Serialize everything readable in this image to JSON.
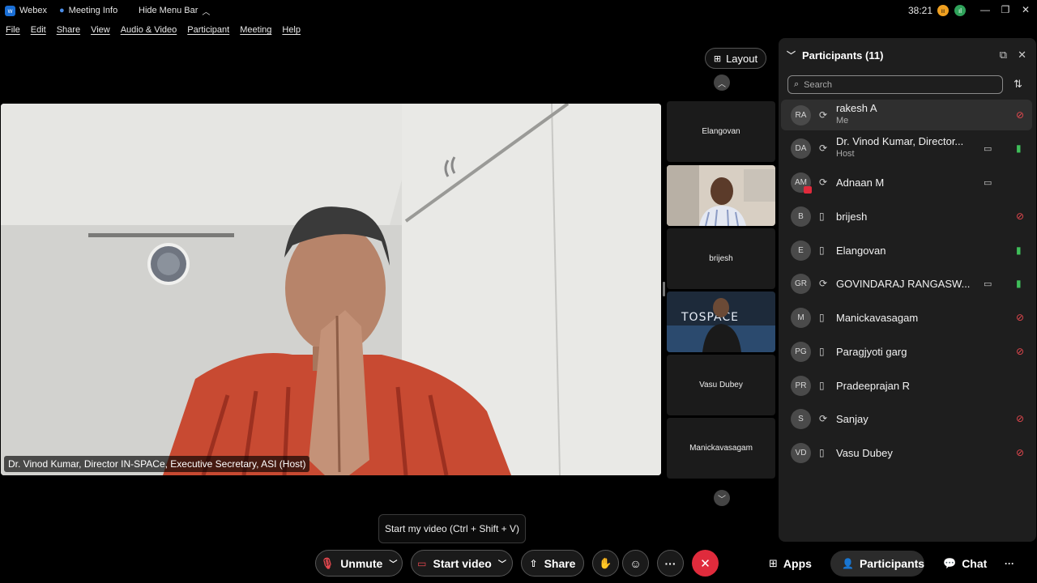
{
  "titlebar": {
    "app_name": "Webex",
    "meeting_info": "Meeting Info",
    "hide_menu": "Hide Menu Bar",
    "timer": "38:21"
  },
  "menu": [
    "File",
    "Edit",
    "Share",
    "View",
    "Audio & Video",
    "Participant",
    "Meeting",
    "Help"
  ],
  "stage": {
    "name_tag": "Dr. Vinod Kumar, Director IN-SPACe, Executive Secretary, ASI (Host)"
  },
  "layout_button": "Layout",
  "thumbnails": [
    {
      "label": "Elangovan",
      "video": false
    },
    {
      "label": "",
      "video": true
    },
    {
      "label": "brijesh",
      "video": false
    },
    {
      "label": "",
      "video": true
    },
    {
      "label": "Vasu Dubey",
      "video": false
    },
    {
      "label": "Manickavasagam",
      "video": false
    }
  ],
  "participants_panel": {
    "title": "Participants (11)",
    "search_placeholder": "Search",
    "participants": [
      {
        "initials": "RA",
        "name": "rakesh A",
        "sub": "Me",
        "device": "sync",
        "camera": false,
        "mic": "muted"
      },
      {
        "initials": "DA",
        "name": "Dr. Vinod Kumar, Director...",
        "sub": "Host",
        "device": "sync",
        "camera": true,
        "mic": "on"
      },
      {
        "initials": "AM",
        "name": "Adnaan M",
        "sub": "",
        "device": "sync",
        "camera": true,
        "mic": "none"
      },
      {
        "initials": "B",
        "name": "brijesh",
        "sub": "",
        "device": "phone",
        "camera": false,
        "mic": "muted"
      },
      {
        "initials": "E",
        "name": "Elangovan",
        "sub": "",
        "device": "phone",
        "camera": false,
        "mic": "on"
      },
      {
        "initials": "GR",
        "name": "GOVINDARAJ RANGASW...",
        "sub": "",
        "device": "sync",
        "camera": true,
        "mic": "on"
      },
      {
        "initials": "M",
        "name": "Manickavasagam",
        "sub": "",
        "device": "phone",
        "camera": false,
        "mic": "muted"
      },
      {
        "initials": "PG",
        "name": "Paragjyoti garg",
        "sub": "",
        "device": "phone",
        "camera": false,
        "mic": "muted"
      },
      {
        "initials": "PR",
        "name": "Pradeeprajan R",
        "sub": "",
        "device": "phone",
        "camera": false,
        "mic": "none"
      },
      {
        "initials": "S",
        "name": "Sanjay",
        "sub": "",
        "device": "sync",
        "camera": false,
        "mic": "muted"
      },
      {
        "initials": "VD",
        "name": "Vasu Dubey",
        "sub": "",
        "device": "phone",
        "camera": false,
        "mic": "muted"
      }
    ]
  },
  "tooltip": "Start my video (Ctrl + Shift + V)",
  "controls": {
    "unmute": "Unmute",
    "start_video": "Start video",
    "share": "Share",
    "apps": "Apps",
    "participants": "Participants",
    "chat": "Chat"
  },
  "colors": {
    "end_call": "#e02b3c",
    "muted": "#e8484f",
    "mic_on": "#3fbf5a"
  }
}
